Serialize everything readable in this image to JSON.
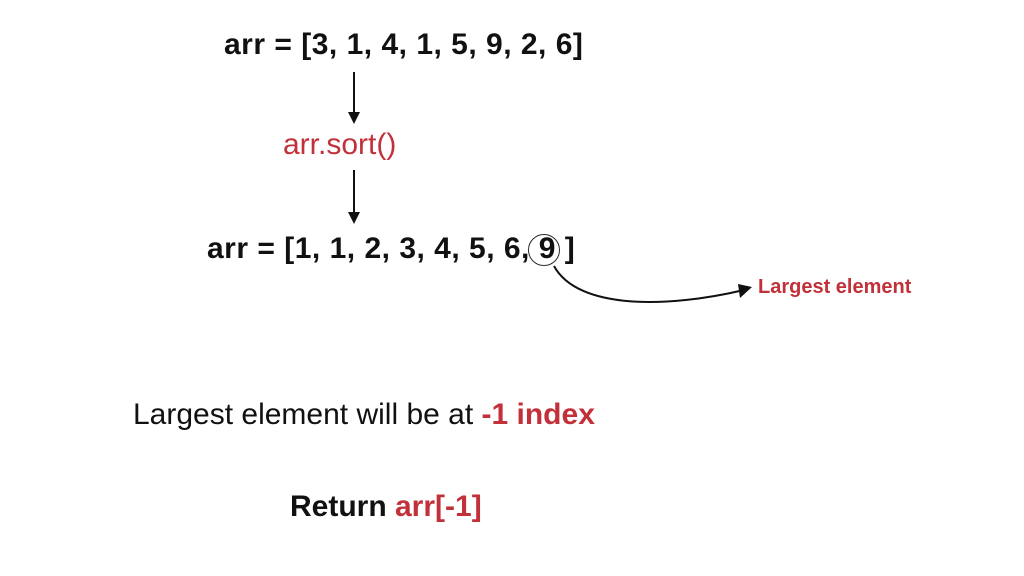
{
  "colors": {
    "accent": "#c2303a",
    "ink": "#111111"
  },
  "line1": {
    "var": "arr",
    "eq": " = ",
    "open": "[",
    "values": [
      3,
      1,
      4,
      1,
      5,
      9,
      2,
      6
    ],
    "close": "]"
  },
  "sort_call": "arr.sort()",
  "line2": {
    "var": "arr",
    "eq": " = ",
    "open": "[",
    "values": [
      1,
      1,
      2,
      3,
      4,
      5,
      6,
      9
    ],
    "close": " ]"
  },
  "annotation": "Largest element",
  "explain_prefix": "Largest element will be at ",
  "explain_highlight": "-1 index",
  "return_prefix": "Return ",
  "return_highlight": "arr[-1]",
  "icons": {
    "arrow_down": "arrow-down-icon",
    "arrow_curve": "arrow-curve-icon",
    "circle": "circle-marker"
  }
}
